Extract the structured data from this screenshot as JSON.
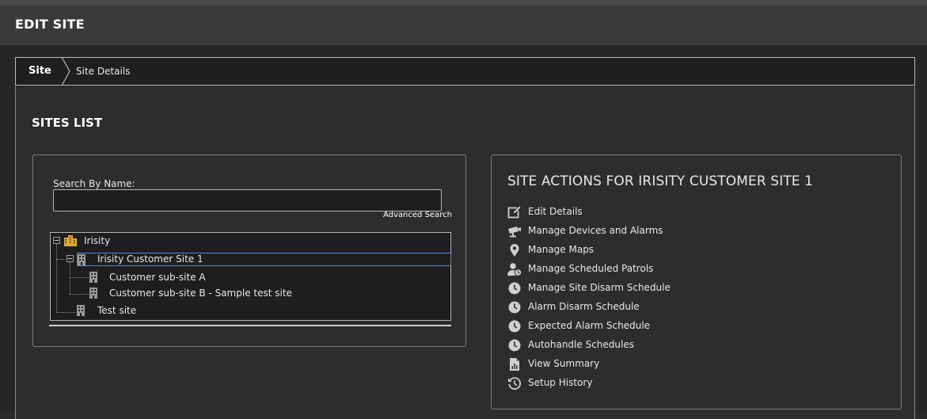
{
  "header": {
    "title": "EDIT SITE"
  },
  "breadcrumb": {
    "items": [
      "Site",
      "Site Details"
    ]
  },
  "sites_list": {
    "title": "SITES LIST",
    "search": {
      "label": "Search By Name:",
      "value": "",
      "placeholder": ""
    },
    "advanced_search_label": "Advanced Search",
    "tree": {
      "root": "Irisity",
      "selected": "Irisity Customer Site 1",
      "children": [
        {
          "label": "Irisity Customer Site 1",
          "children": [
            "Customer sub-site A",
            "Customer sub-site B - Sample test site"
          ]
        },
        {
          "label": "Test site"
        }
      ]
    }
  },
  "site_actions": {
    "title": "SITE ACTIONS FOR IRISITY CUSTOMER SITE 1",
    "items": [
      {
        "label": "Edit Details",
        "icon": "edit-icon"
      },
      {
        "label": "Manage Devices and Alarms",
        "icon": "camera-icon"
      },
      {
        "label": "Manage Maps",
        "icon": "map-pin-icon"
      },
      {
        "label": "Manage Scheduled Patrols",
        "icon": "user-clock-icon"
      },
      {
        "label": "Manage Site Disarm Schedule",
        "icon": "clock-icon"
      },
      {
        "label": "Alarm Disarm Schedule",
        "icon": "clock-icon"
      },
      {
        "label": "Expected Alarm Schedule",
        "icon": "clock-icon"
      },
      {
        "label": "Autohandle Schedules",
        "icon": "clock-icon"
      },
      {
        "label": "View Summary",
        "icon": "report-icon"
      },
      {
        "label": "Setup History",
        "icon": "history-icon"
      }
    ]
  },
  "colors": {
    "background": "#262626",
    "header": "#3a3a3a",
    "selection_border": "#4a8fd6",
    "root_icon": "#e0a82e"
  }
}
